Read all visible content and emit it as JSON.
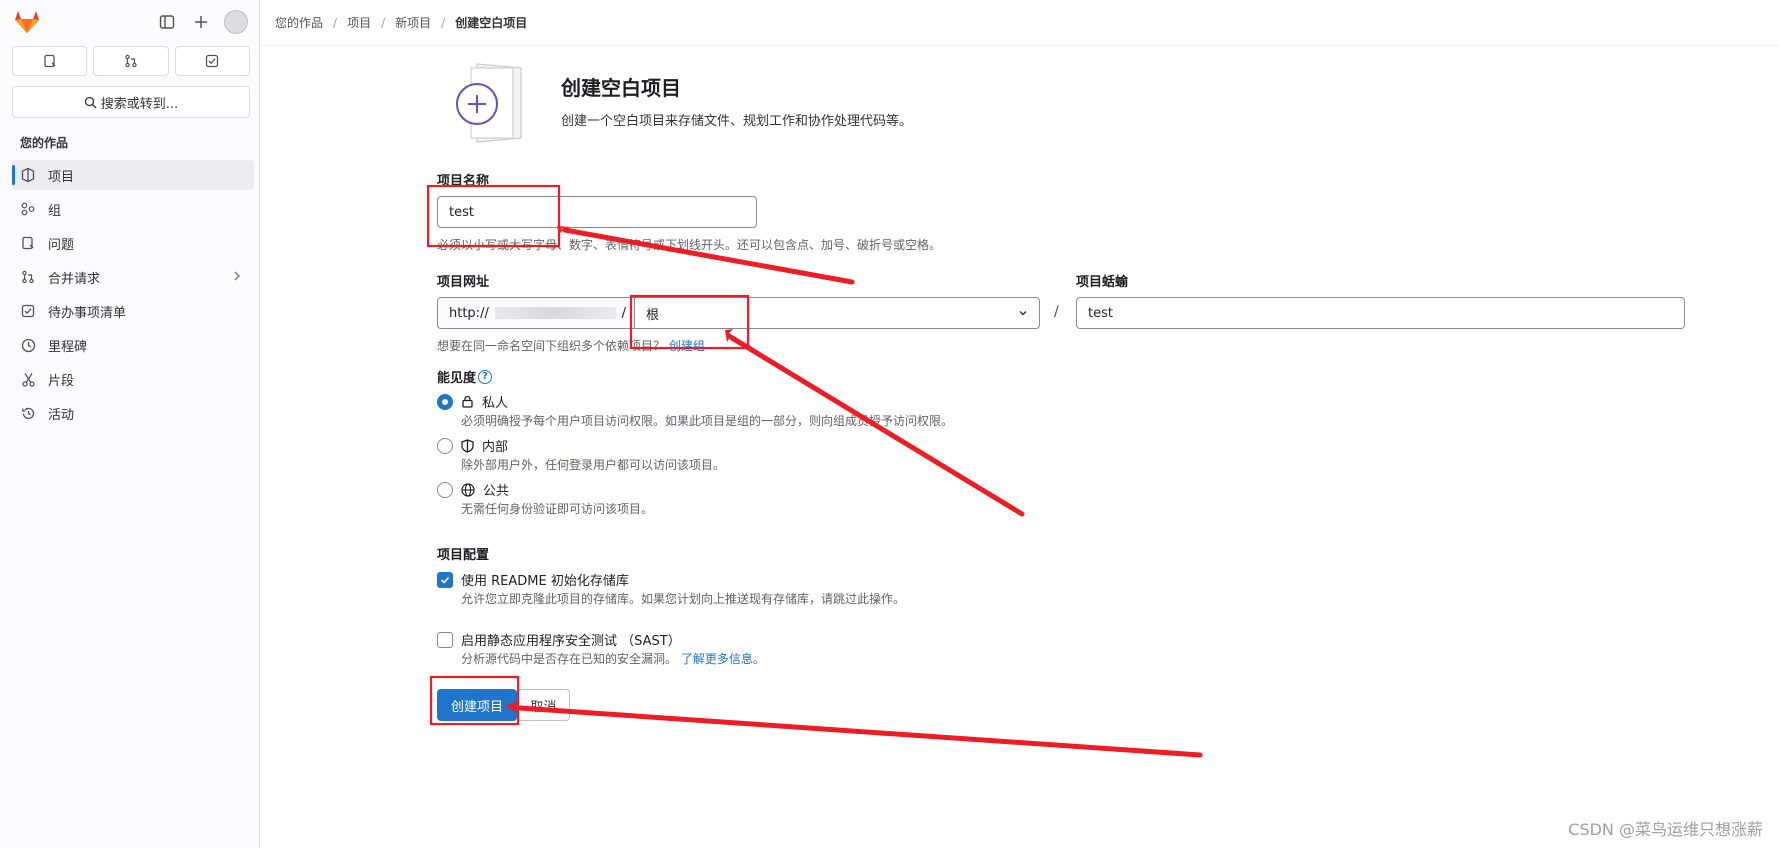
{
  "sidebar": {
    "section_title": "您的作品",
    "search_label": "搜索或转到...",
    "items": [
      {
        "label": "项目",
        "icon": "project-icon",
        "active": true
      },
      {
        "label": "组",
        "icon": "group-icon"
      },
      {
        "label": "问题",
        "icon": "issues-icon"
      },
      {
        "label": "合并请求",
        "icon": "merge-request-icon",
        "has_chevron": true
      },
      {
        "label": "待办事项清单",
        "icon": "todo-icon"
      },
      {
        "label": "里程碑",
        "icon": "clock-icon"
      },
      {
        "label": "片段",
        "icon": "scissors-icon"
      },
      {
        "label": "活动",
        "icon": "history-icon"
      }
    ]
  },
  "breadcrumb": [
    "您的作品",
    "项目",
    "新项目",
    "创建空白项目"
  ],
  "hero": {
    "title": "创建空白项目",
    "description": "创建一个空白项目来存储文件、规划工作和协作处理代码等。"
  },
  "form": {
    "project_name_label": "项目名称",
    "project_name_value": "test",
    "project_name_help": "必须以小写或大写字母、数字、表情符号或下划线开头。还可以包含点、加号、破折号或空格。",
    "project_url_label": "项目网址",
    "project_url_prefix": "http://",
    "project_url_suffix": "/",
    "namespace_value": "根",
    "slug_separator": "/",
    "project_slug_label": "项目蛞蝓",
    "project_slug_value": "test",
    "namespace_help": "想要在同一命名空间下组织多个依赖项目？",
    "namespace_help_link": "创建组",
    "visibility_label": "能见度",
    "visibility_help_icon": "?",
    "visibility_options": [
      {
        "label": "私人",
        "icon": "lock-icon",
        "desc": "必须明确授予每个用户项目访问权限。如果此项目是组的一部分，则向组成员授予访问权限。",
        "selected": true
      },
      {
        "label": "内部",
        "icon": "shield-icon",
        "desc": "除外部用户外，任何登录用户都可以访问该项目。",
        "selected": false
      },
      {
        "label": "公共",
        "icon": "globe-icon",
        "desc": "无需任何身份验证即可访问该项目。",
        "selected": false
      }
    ],
    "config_label": "项目配置",
    "readme_label": "使用 README 初始化存储库",
    "readme_desc": "允许您立即克隆此项目的存储库。如果您计划向上推送现有存储库，请跳过此操作。",
    "readme_checked": true,
    "sast_label": "启用静态应用程序安全测试 （SAST）",
    "sast_desc": "分析源代码中是否存在已知的安全漏洞。",
    "sast_link": "了解更多信息。",
    "sast_checked": false,
    "create_button": "创建项目",
    "cancel_button": "取消"
  },
  "watermark": "CSDN @菜鸟运维只想涨薪",
  "colors": {
    "accent": "#1f75cb",
    "annotation": "#ee1c25",
    "logo": "#e24329"
  }
}
